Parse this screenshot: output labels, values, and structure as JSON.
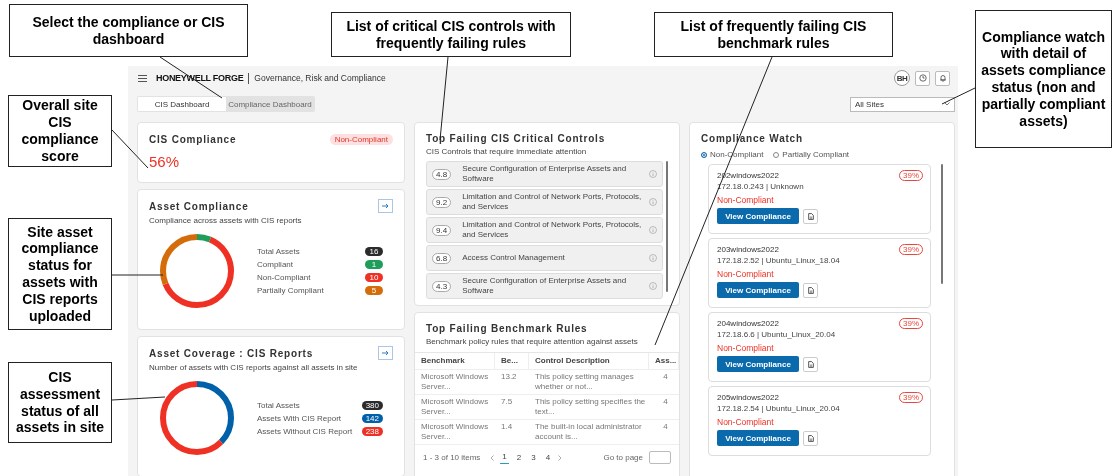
{
  "annotations": [
    {
      "text": "Select the compliance or CIS dashboard"
    },
    {
      "text": "List of critical CIS controls with frequently failing rules"
    },
    {
      "text": "List of frequently failing CIS benchmark rules"
    },
    {
      "text": "Compliance watch with detail of assets compliance status (non and partially compliant assets)"
    },
    {
      "text": "Overall site CIS compliance score"
    },
    {
      "text": "Site asset compliance status for assets with CIS reports uploaded"
    },
    {
      "text": "CIS assessment status of all assets in site"
    }
  ],
  "header": {
    "brand": "HONEYWELL FORGE",
    "app_title": "Governance, Risk and Compliance",
    "avatar": "BH"
  },
  "tabs": [
    {
      "label": "CIS Dashboard",
      "selected": true
    },
    {
      "label": "Compliance Dashboard",
      "selected": false
    }
  ],
  "site_select": {
    "value": "All Sites"
  },
  "cis_compliance": {
    "title": "CIS Compliance",
    "status": "Non-Compliant",
    "score": "56%"
  },
  "asset_compliance": {
    "title": "Asset Compliance",
    "subtitle": "Compliance across assets with CIS reports",
    "legend": [
      {
        "label": "Total Assets",
        "count": "16",
        "color": "#2b2b2b",
        "kind": "total"
      },
      {
        "label": "Compliant",
        "count": "1",
        "color": "#1e9e5a",
        "kind": "part"
      },
      {
        "label": "Non-Compliant",
        "count": "10",
        "color": "#ee3124",
        "kind": "part"
      },
      {
        "label": "Partially Compliant",
        "count": "5",
        "color": "#d46c0a",
        "kind": "part"
      }
    ]
  },
  "asset_coverage": {
    "title": "Asset Coverage : CIS Reports",
    "subtitle": "Number of assets with CIS reports against all assets in site",
    "legend": [
      {
        "label": "Total Assets",
        "count": "380",
        "color": "#2b2b2b",
        "kind": "total"
      },
      {
        "label": "Assets With CIS Report",
        "count": "142",
        "color": "#0060a9",
        "kind": "part"
      },
      {
        "label": "Assets Without CIS Report",
        "count": "238",
        "color": "#ee3124",
        "kind": "part"
      }
    ]
  },
  "critical_controls": {
    "title": "Top Failing CIS Critical Controls",
    "subtitle": "CIS Controls that require immediate attention",
    "items": [
      {
        "id": "4.8",
        "label": "Secure Configuration of Enterprise Assets and Software"
      },
      {
        "id": "9.2",
        "label": "Limitation and Control of Network Ports, Protocols, and Services"
      },
      {
        "id": "9.4",
        "label": "Limitation and Control of Network Ports, Protocols, and Services"
      },
      {
        "id": "6.8",
        "label": "Access Control Management"
      },
      {
        "id": "4.3",
        "label": "Secure Configuration of Enterprise Assets and Software"
      }
    ]
  },
  "benchmark_rules": {
    "title": "Top Failing Benchmark Rules",
    "subtitle": "Benchmark policy rules that require attention against assets",
    "columns": [
      "Benchmark",
      "Be...",
      "Control Description",
      "Ass..."
    ],
    "rows": [
      [
        "Microsoft Windows Server...",
        "13.2",
        "This policy setting manages whether or not...",
        "4"
      ],
      [
        "Microsoft Windows Server...",
        "7.5",
        "This policy setting specifies the text...",
        "4"
      ],
      [
        "Microsoft Windows Server...",
        "1.4",
        "The built-in local administrator account is...",
        "4"
      ]
    ],
    "summary": "1 - 3 of 10 items",
    "pages": [
      {
        "label": "1",
        "selected": true
      },
      {
        "label": "2",
        "selected": false
      },
      {
        "label": "3",
        "selected": false
      },
      {
        "label": "4",
        "selected": false
      }
    ],
    "goto_label": "Go to page"
  },
  "compliance_watch": {
    "title": "Compliance Watch",
    "filters": [
      {
        "label": "Non-Compliant",
        "selected": true
      },
      {
        "label": "Partially Compliant",
        "selected": false
      }
    ],
    "assets": [
      {
        "name": "202windows2022",
        "detail": "172.18.0.243 | Unknown",
        "status": "Non-Compliant",
        "score": "39%",
        "button": "View Compliance"
      },
      {
        "name": "203windows2022",
        "detail": "172.18.2.52 | Ubuntu_Linux_18.04",
        "status": "Non-Compliant",
        "score": "39%",
        "button": "View Compliance"
      },
      {
        "name": "204windows2022",
        "detail": "172.18.6.6 | Ubuntu_Linux_20.04",
        "status": "Non-Compliant",
        "score": "39%",
        "button": "View Compliance"
      },
      {
        "name": "205windows2022",
        "detail": "172.18.2.54 | Ubuntu_Linux_20.04",
        "status": "Non-Compliant",
        "score": "39%",
        "button": "View Compliance"
      }
    ]
  }
}
